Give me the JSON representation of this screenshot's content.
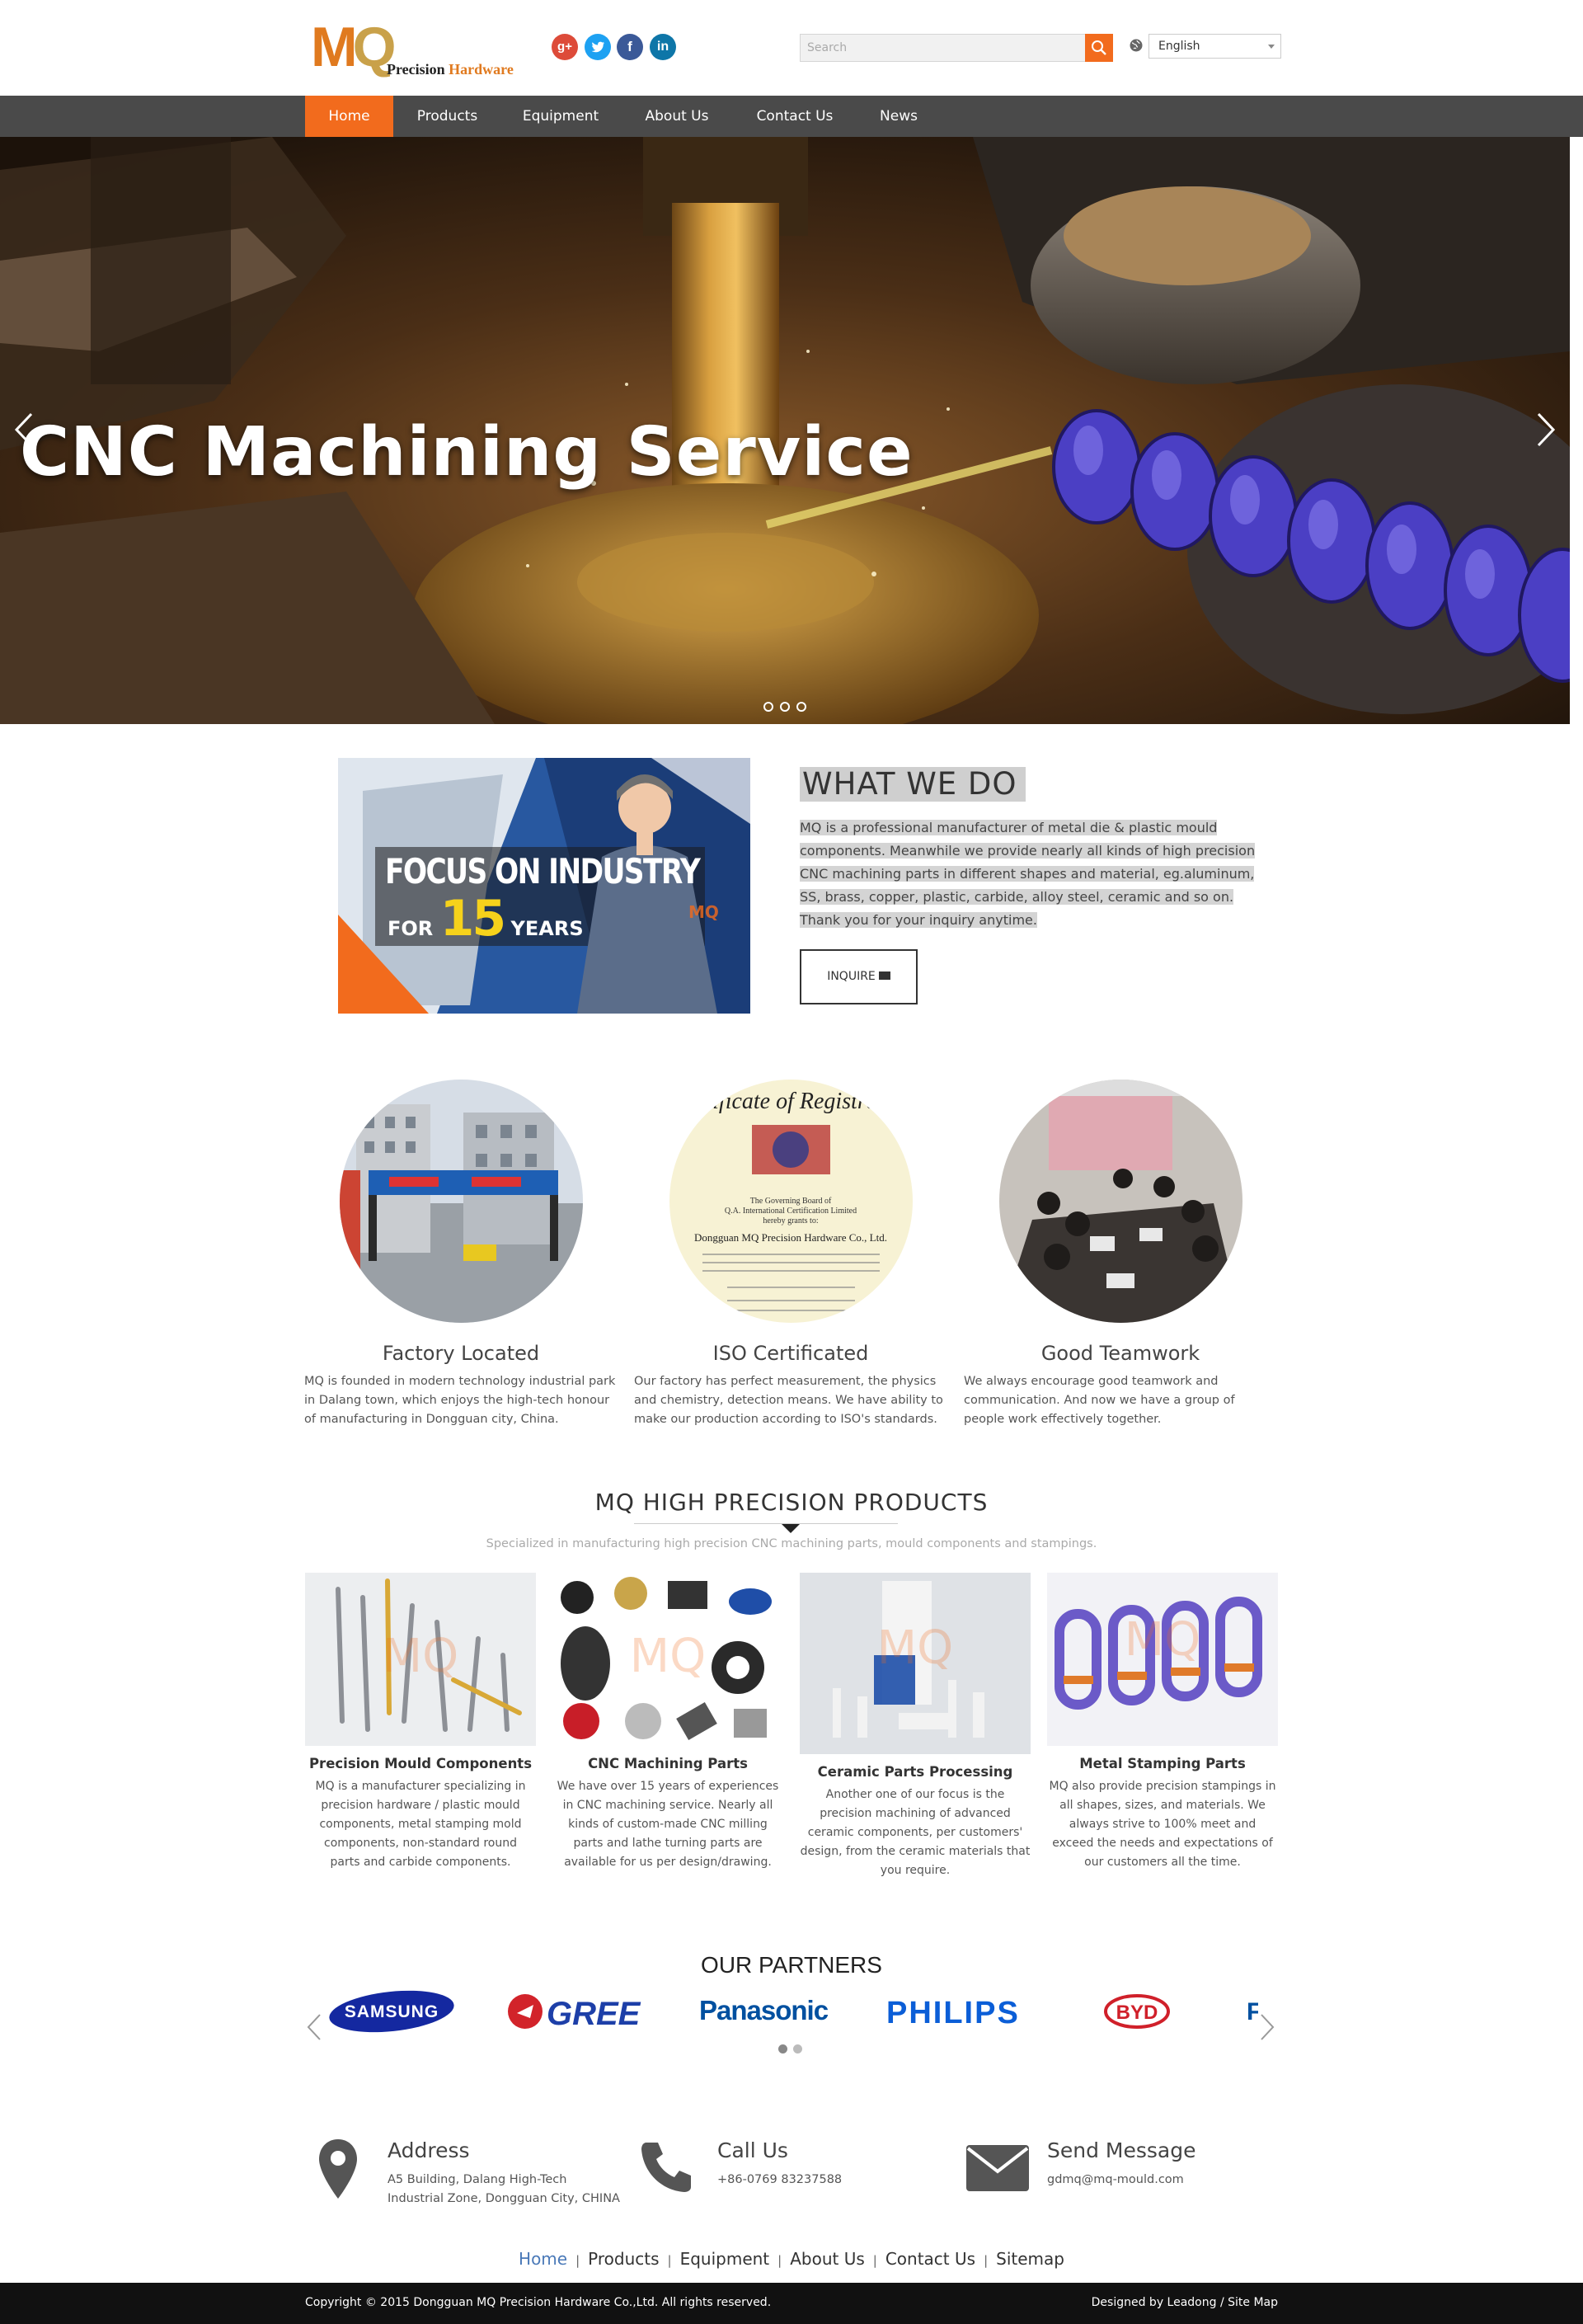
{
  "header": {
    "logo_mark": "MQ",
    "logo_sub_1": "Precision ",
    "logo_sub_2": "Hardware",
    "social": [
      {
        "icon": "google-plus-icon",
        "glyph": "g+"
      },
      {
        "icon": "twitter-icon",
        "glyph": "t"
      },
      {
        "icon": "facebook-icon",
        "glyph": "f"
      },
      {
        "icon": "linkedin-icon",
        "glyph": "in"
      }
    ],
    "search": {
      "placeholder": "Search",
      "value": ""
    },
    "language": "English",
    "colors": {
      "accent": "#f26b1d",
      "nav_bg": "#4a4a4a"
    }
  },
  "nav": {
    "items": [
      {
        "label": "Home",
        "active": true
      },
      {
        "label": "Products"
      },
      {
        "label": "Equipment"
      },
      {
        "label": "About Us"
      },
      {
        "label": "Contact Us"
      },
      {
        "label": "News"
      }
    ]
  },
  "hero": {
    "title": "CNC Machining Service",
    "slides": 3,
    "active_slide": 1
  },
  "about": {
    "image_line1": "FOCUS ON INDUSTRY",
    "image_for": "FOR ",
    "image_number": "15",
    "image_years": " YEARS",
    "image_mark": "MQ",
    "title": "WHAT WE DO",
    "text_lines": [
      "MQ is a professional manufacturer of metal die & plastic mould",
      "components. Meanwhile we provide nearly all kinds of high precision",
      "CNC machining parts in different shapes and material, eg.aluminum,",
      "SS, brass, copper, plastic, carbide, alloy steel, ceramic and so on.",
      "Thank you for your inquiry anytime."
    ],
    "button": "INQUIRE"
  },
  "features": [
    {
      "title": "Factory Located",
      "desc": "MQ is founded in modern technology industrial park in Dalang town, which enjoys the high-tech honour of manufacturing in Dongguan city, China."
    },
    {
      "title": "ISO Certificated",
      "desc": "Our factory has perfect measurement, the physics and chemistry, detection means. We have ability to make our production according to ISO's standards."
    },
    {
      "title": "Good Teamwork",
      "desc": "We always encourage good teamwork and communication. And now we have a group of people work effectively together."
    }
  ],
  "certificate": {
    "heading": "rtificate of Registrat",
    "board_1": "The Governing Board of",
    "board_2": "Q.A. International Certification Limited",
    "board_3": "hereby grants to:",
    "company": "Dongguan MQ Precision Hardware Co., Ltd."
  },
  "products_section": {
    "heading": "MQ HIGH PRECISION PRODUCTS",
    "subheading": "Specialized in manufacturing high precision CNC machining parts, mould components and stampings.",
    "watermark": "MQ",
    "items": [
      {
        "title": "Precision Mould Components",
        "desc_lines": [
          "MQ is a manufacturer specializing in",
          "precision hardware / plastic  mould",
          "components, metal stamping mold",
          "components, non-standard round",
          "parts and carbide components."
        ]
      },
      {
        "title": "CNC Machining Parts",
        "desc_lines": [
          "We have over 15 years of experiences",
          "in CNC machining service. Nearly all",
          "kinds of custom-made CNC milling",
          "parts and lathe turning parts are",
          "available for us per design/drawing."
        ]
      },
      {
        "title": "Ceramic Parts Processing",
        "desc_lines": [
          "Another one  of our focus is the",
          "precision machining of advanced",
          "ceramic components, per customers'",
          "design, from the ceramic materials that",
          "you require."
        ]
      },
      {
        "title": "Metal Stamping Parts",
        "desc_lines": [
          "MQ also provide precision stampings in",
          "all shapes, sizes, and materials. We",
          "always strive to 100% meet and",
          "exceed the needs and expectations of",
          "our customers all the time."
        ]
      }
    ]
  },
  "partners": {
    "heading": "OUR PARTNERS",
    "logos": [
      "SAMSUNG",
      "GREE",
      "Panasonic",
      "PHILIPS",
      "BYD",
      "F"
    ],
    "colors": {
      "samsung": "#1428a0",
      "gree": "#1d3fa8",
      "panasonic": "#0050a0",
      "philips": "#0b5ed7",
      "byd": "#d0202a"
    }
  },
  "contact": {
    "address_title": "Address",
    "address_lines": [
      "A5 Building, Dalang High-Tech",
      "Industrial Zone, Dongguan City, CHINA"
    ],
    "call_title": "Call Us",
    "phone": "+86-0769 83237588",
    "message_title": "Send Message",
    "email": "gdmq@mq-mould.com"
  },
  "footer": {
    "links": [
      "Home",
      "Products",
      "Equipment",
      "About Us",
      "Contact Us",
      "Sitemap"
    ],
    "separator": "|",
    "copyright": "Copyright © 2015 Dongguan MQ Precision Hardware Co.,Ltd.  All rights reserved.",
    "designed_by": "Designed by Leadong  / Site Map"
  }
}
